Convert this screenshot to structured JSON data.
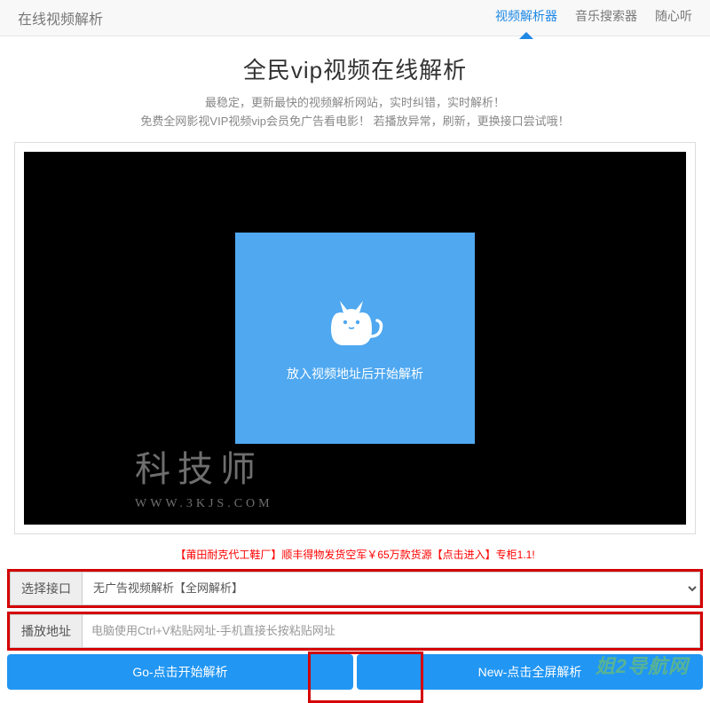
{
  "navbar": {
    "brand": "在线视频解析",
    "links": [
      "视频解析器",
      "音乐搜索器",
      "随心听"
    ]
  },
  "title": "全民vip视频在线解析",
  "subtitle_line1": "最稳定，更新最快的视频解析网站，实时纠错，实时解析！",
  "subtitle_line2": "免费全网影视VIP视频vip会员免广告看电影！ 若播放异常，刷新，更换接口尝试哦！",
  "player_prompt": "放入视频地址后开始解析",
  "watermark_main": "科技师",
  "watermark_sub": "WWW.3KJS.COM",
  "ad_text": "【莆田耐克代工鞋厂】顺丰得物发货空军￥65万款货源【点击进入】专柜1.1!",
  "form": {
    "interface_label": "选择接口",
    "interface_selected": "无广告视频解析【全网解析】",
    "address_label": "播放地址",
    "address_placeholder": "电脑使用Ctrl+V粘贴网址-手机直接长按粘贴网址"
  },
  "buttons": {
    "go": "Go-点击开始解析",
    "new": "New-点击全屏解析"
  },
  "footer_watermark": "姐2导航网"
}
